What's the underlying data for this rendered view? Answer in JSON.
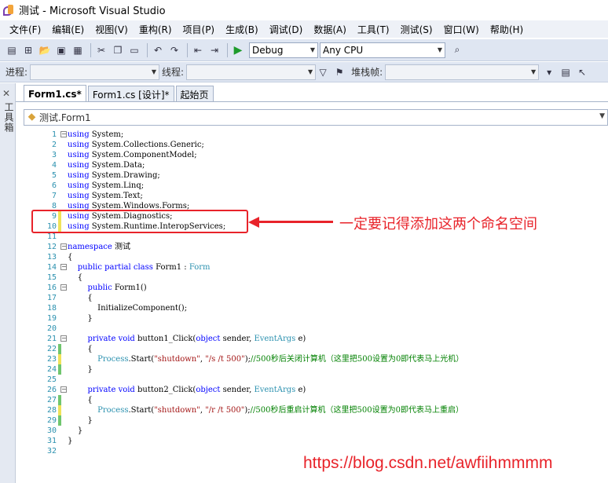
{
  "window": {
    "title": "测试 - Microsoft Visual Studio"
  },
  "menu": [
    "文件(F)",
    "编辑(E)",
    "视图(V)",
    "重构(R)",
    "项目(P)",
    "生成(B)",
    "调试(D)",
    "数据(A)",
    "工具(T)",
    "测试(S)",
    "窗口(W)",
    "帮助(H)"
  ],
  "toolbar": {
    "config": "Debug",
    "platform": "Any CPU"
  },
  "debug_toolbar": {
    "process_label": "进程:",
    "thread_label": "线程:",
    "stack_label": "堆栈帧:"
  },
  "toolbox_label": "工具箱",
  "tabs": [
    "Form1.cs*",
    "Form1.cs [设计]*",
    "起始页"
  ],
  "navbar": {
    "class_label": "测试.Form1"
  },
  "code_lines": [
    "using System;",
    "using System.Collections.Generic;",
    "using System.ComponentModel;",
    "using System.Data;",
    "using System.Drawing;",
    "using System.Linq;",
    "using System.Text;",
    "using System.Windows.Forms;",
    "using System.Diagnostics;",
    "using System.Runtime.InteropServices;",
    "",
    "namespace 测试",
    "{",
    "    public partial class Form1 : Form",
    "    {",
    "        public Form1()",
    "        {",
    "            InitializeComponent();",
    "        }",
    "",
    "        private void button1_Click(object sender, EventArgs e)",
    "        {",
    "            Process.Start(\"shutdown\", \"/s /t 500\");//500秒后关闭计算机（这里把500设置为0即代表马上光机）",
    "        }",
    "",
    "        private void button2_Click(object sender, EventArgs e)",
    "        {",
    "            Process.Start(\"shutdown\", \"/r /t 500\");//500秒后重启计算机（这里把500设置为0即代表马上重启）",
    "        }",
    "    }",
    "}",
    ""
  ],
  "annotation": "一定要记得添加这两个命名空间",
  "watermark": "https://blog.csdn.net/awfiihmmmm",
  "colors": {
    "keyword": "#0000ff",
    "type": "#2b91af",
    "string": "#a31515",
    "comment": "#008000",
    "annotation": "#e8232a"
  }
}
